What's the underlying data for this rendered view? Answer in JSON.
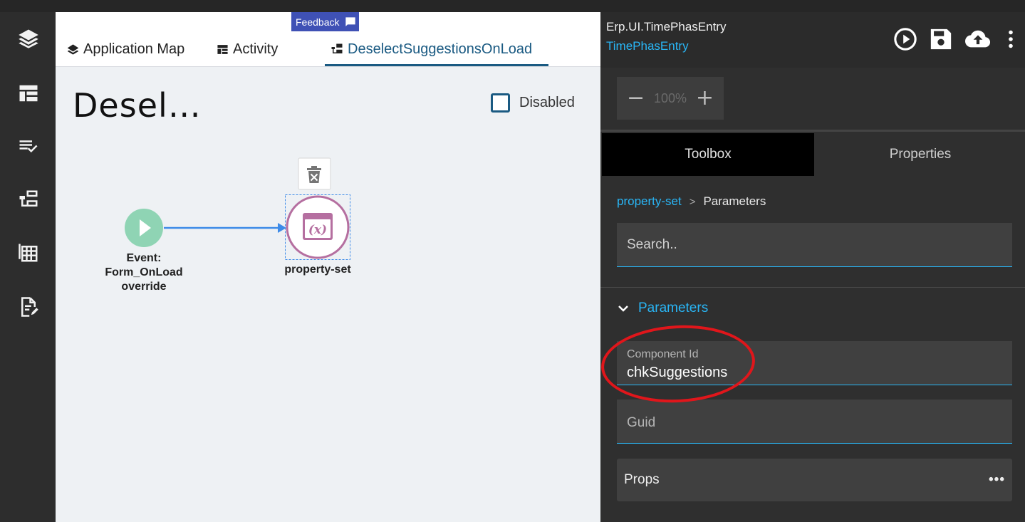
{
  "left_nav": {
    "icons": [
      "layers-icon",
      "table-layout-icon",
      "checklist-icon",
      "workflow-icon",
      "grid-icon",
      "edit-document-icon"
    ]
  },
  "tabs": {
    "feedback_label": "Feedback",
    "items": [
      {
        "label": "Application Map",
        "icon": "layers-icon"
      },
      {
        "label": "Activity",
        "icon": "table-icon"
      },
      {
        "label": "DeselectSuggestionsOnLoad",
        "icon": "workflow-icon",
        "active": true
      }
    ]
  },
  "canvas": {
    "title": "Desel…",
    "disabled_label": "Disabled",
    "disabled_checked": false,
    "start_node": {
      "line1": "Event:",
      "line2": "Form_OnLoad",
      "line3": "override"
    },
    "action_node": {
      "label": "property-set"
    }
  },
  "right_panel": {
    "title": "Erp.UI.TimePhasEntry",
    "subtitle": "TimePhasEntry",
    "zoom": {
      "value": "100%",
      "minus": "−",
      "plus": "+"
    },
    "tabs": {
      "toolbox": "Toolbox",
      "properties": "Properties"
    },
    "breadcrumb": {
      "link": "property-set",
      "separator": ">",
      "current": "Parameters"
    },
    "search": {
      "placeholder": "Search.."
    },
    "section": {
      "label": "Parameters"
    },
    "fields": {
      "component_id": {
        "label": "Component Id",
        "value": "chkSuggestions"
      },
      "guid": {
        "placeholder": "Guid"
      }
    },
    "props": {
      "label": "Props",
      "menu": "•••"
    }
  },
  "colors": {
    "accent": "#29b6f6",
    "tab_active": "#1a5a82",
    "feedback_bg": "#3f51b5",
    "start_node": "#8fd4b4",
    "action_node": "#b56fa0",
    "edge": "#3d8be8",
    "annotation_ring": "#e0161b"
  }
}
